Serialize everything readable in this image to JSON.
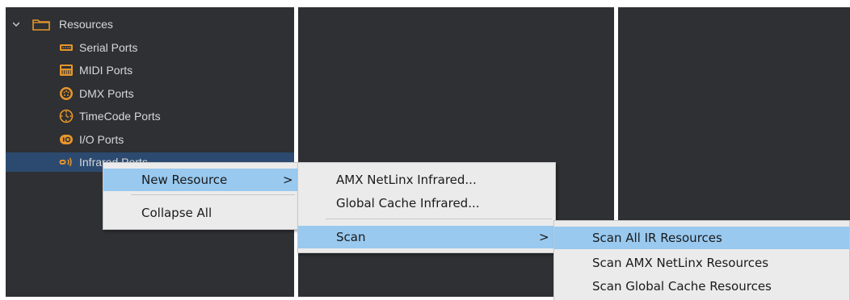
{
  "tree": {
    "top_label": "Resources",
    "items": [
      {
        "label": "Serial Ports",
        "icon": "serial-port-icon"
      },
      {
        "label": "MIDI Ports",
        "icon": "midi-port-icon"
      },
      {
        "label": "DMX Ports",
        "icon": "dmx-port-icon"
      },
      {
        "label": "TimeCode Ports",
        "icon": "timecode-port-icon"
      },
      {
        "label": "I/O Ports",
        "icon": "io-port-icon"
      },
      {
        "label": "Infrared Ports",
        "icon": "infrared-port-icon"
      }
    ],
    "icon_color": "#e8962a",
    "selection_color": "#2c4a70",
    "panel_color": "#2e3033"
  },
  "context_menu": {
    "items": [
      {
        "label": "New Resource",
        "arrow": ">"
      },
      {
        "label": "Collapse All"
      }
    ]
  },
  "new_resource_menu": {
    "items": [
      {
        "label": "AMX NetLinx Infrared..."
      },
      {
        "label": "Global Cache Infrared..."
      },
      {
        "label": "Scan",
        "arrow": ">"
      }
    ]
  },
  "scan_menu": {
    "items": [
      {
        "label": "Scan All IR Resources"
      },
      {
        "label": "Scan AMX NetLinx Resources"
      },
      {
        "label": "Scan Global Cache Resources"
      }
    ]
  },
  "menu_highlight_color": "#99c9ef"
}
